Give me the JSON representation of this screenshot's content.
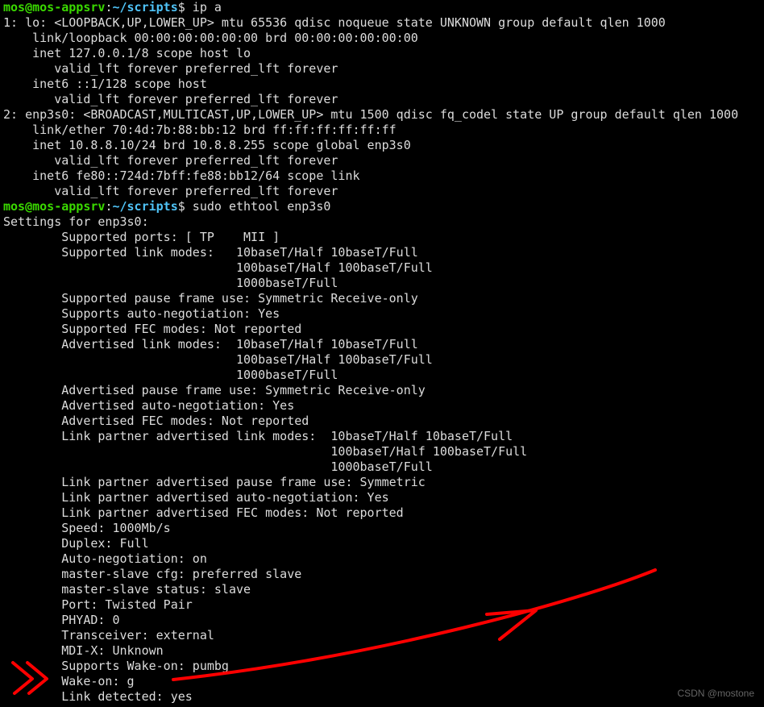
{
  "prompt": {
    "user": "mos",
    "host": "mos-appsrv",
    "path": "~/scripts",
    "symbol": "$"
  },
  "cmd1": "ip a",
  "ip_output": [
    "1: lo: <LOOPBACK,UP,LOWER_UP> mtu 65536 qdisc noqueue state UNKNOWN group default qlen 1000",
    "    link/loopback 00:00:00:00:00:00 brd 00:00:00:00:00:00",
    "    inet 127.0.0.1/8 scope host lo",
    "       valid_lft forever preferred_lft forever",
    "    inet6 ::1/128 scope host",
    "       valid_lft forever preferred_lft forever",
    "2: enp3s0: <BROADCAST,MULTICAST,UP,LOWER_UP> mtu 1500 qdisc fq_codel state UP group default qlen 1000",
    "    link/ether 70:4d:7b:88:bb:12 brd ff:ff:ff:ff:ff:ff",
    "    inet 10.8.8.10/24 brd 10.8.8.255 scope global enp3s0",
    "       valid_lft forever preferred_lft forever",
    "    inet6 fe80::724d:7bff:fe88:bb12/64 scope link",
    "       valid_lft forever preferred_lft forever"
  ],
  "cmd2": "sudo ethtool enp3s0",
  "ethtool_output": [
    "Settings for enp3s0:",
    "        Supported ports: [ TP    MII ]",
    "        Supported link modes:   10baseT/Half 10baseT/Full",
    "                                100baseT/Half 100baseT/Full",
    "                                1000baseT/Full",
    "        Supported pause frame use: Symmetric Receive-only",
    "        Supports auto-negotiation: Yes",
    "        Supported FEC modes: Not reported",
    "        Advertised link modes:  10baseT/Half 10baseT/Full",
    "                                100baseT/Half 100baseT/Full",
    "                                1000baseT/Full",
    "        Advertised pause frame use: Symmetric Receive-only",
    "        Advertised auto-negotiation: Yes",
    "        Advertised FEC modes: Not reported",
    "        Link partner advertised link modes:  10baseT/Half 10baseT/Full",
    "                                             100baseT/Half 100baseT/Full",
    "                                             1000baseT/Full",
    "        Link partner advertised pause frame use: Symmetric",
    "        Link partner advertised auto-negotiation: Yes",
    "        Link partner advertised FEC modes: Not reported",
    "        Speed: 1000Mb/s",
    "        Duplex: Full",
    "        Auto-negotiation: on",
    "        master-slave cfg: preferred slave",
    "        master-slave status: slave",
    "        Port: Twisted Pair",
    "        PHYAD: 0",
    "        Transceiver: external",
    "        MDI-X: Unknown",
    "        Supports Wake-on: pumbg",
    "        Wake-on: g",
    "        Link detected: yes"
  ],
  "watermark": "CSDN @mostone",
  "annotation_color": "#ff0000"
}
